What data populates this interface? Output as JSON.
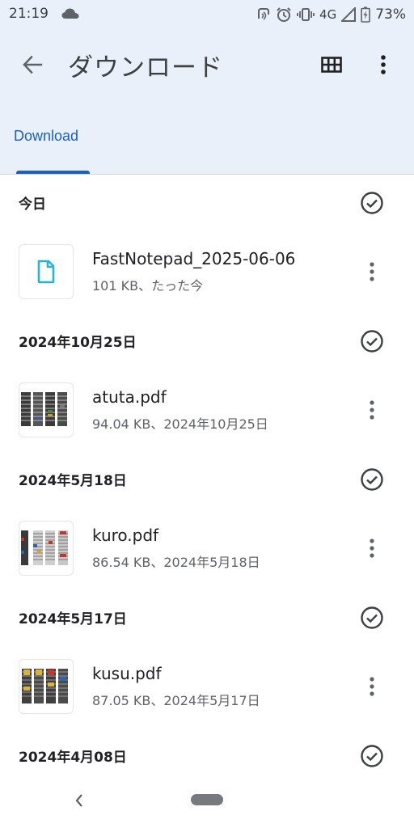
{
  "status_bar": {
    "time": "21:19",
    "network": "4G",
    "battery": "73%",
    "icons": [
      "cloud-icon",
      "nfc-icon",
      "alarm-icon",
      "vibrate-icon",
      "signal-icon",
      "battery-icon"
    ]
  },
  "app_bar": {
    "title": "ダウンロード",
    "back_icon": "arrow-back-icon",
    "grid_icon": "grid-view-icon",
    "more_icon": "more-vert-icon"
  },
  "tabs": [
    {
      "label": "Download",
      "selected": true
    }
  ],
  "sections": [
    {
      "title": "今日",
      "files": [
        {
          "name": "FastNotepad_2025-06-06",
          "meta": "101 KB、たった今",
          "thumbnail": "document-icon"
        }
      ]
    },
    {
      "title": "2024年10月25日",
      "files": [
        {
          "name": "atuta.pdf",
          "meta": "94.04 KB、2024年10月25日",
          "thumbnail": "pdf-preview"
        }
      ]
    },
    {
      "title": "2024年5月18日",
      "files": [
        {
          "name": "kuro.pdf",
          "meta": "86.54 KB、2024年5月18日",
          "thumbnail": "pdf-preview"
        }
      ]
    },
    {
      "title": "2024年5月17日",
      "files": [
        {
          "name": "kusu.pdf",
          "meta": "87.05 KB、2024年5月17日",
          "thumbnail": "pdf-preview"
        }
      ]
    },
    {
      "title": "2024年4月08日",
      "files": []
    }
  ],
  "colors": {
    "header_bg": "#eaf0f9",
    "accent": "#1a5fc4",
    "doc_icon": "#26b3d6",
    "text_primary": "#202124",
    "text_secondary": "#5f6368"
  }
}
